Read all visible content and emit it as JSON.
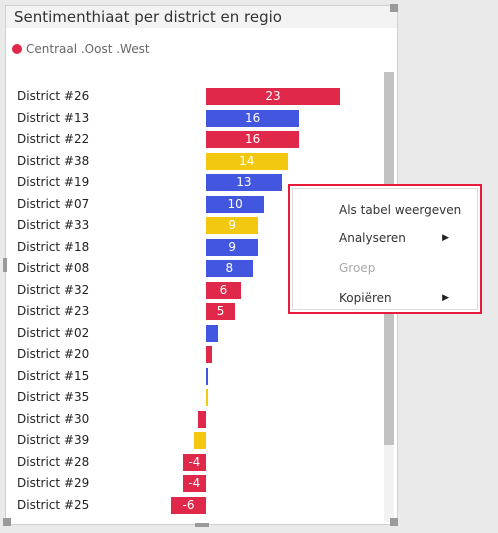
{
  "title": "Sentimenthiaat per district en regio",
  "legend": {
    "label": "Centraal .Oost .West",
    "color": "#e0294a"
  },
  "colors": {
    "Centraal": "#e0294a",
    "Oost": "#4356e0",
    "West": "#f2c811"
  },
  "chart_data": {
    "type": "bar",
    "orientation": "horizontal",
    "categories": [
      "District #26",
      "District #13",
      "District #22",
      "District #38",
      "District #19",
      "District #07",
      "District #33",
      "District #18",
      "District #08",
      "District #32",
      "District #23",
      "District #02",
      "District #20",
      "District #15",
      "District #35",
      "District #30",
      "District #39",
      "District #28",
      "District #29",
      "District #25"
    ],
    "values": [
      23,
      16,
      16,
      14,
      13,
      10,
      9,
      9,
      8,
      6,
      5,
      2,
      1,
      0.2,
      0.3,
      -1.3,
      -2,
      -4,
      -4,
      -6
    ],
    "labels": [
      "23",
      "16",
      "16",
      "14",
      "13",
      "10",
      "9",
      "9",
      "8",
      "6",
      "5",
      "",
      "",
      "",
      "",
      "",
      "",
      "-4",
      "-4",
      "-6"
    ],
    "regions": [
      "Centraal",
      "Oost",
      "Centraal",
      "West",
      "Oost",
      "Oost",
      "West",
      "Oost",
      "Oost",
      "Centraal",
      "Centraal",
      "Oost",
      "Centraal",
      "Oost",
      "West",
      "Centraal",
      "West",
      "Centraal",
      "Centraal",
      "Centraal"
    ]
  },
  "context_menu": {
    "items": [
      {
        "label": "Als tabel weergeven",
        "disabled": false,
        "submenu": false
      },
      {
        "label": "Analyseren",
        "disabled": false,
        "submenu": true
      },
      {
        "label": "Groep",
        "disabled": true,
        "submenu": false
      },
      {
        "label": "Kopiëren",
        "disabled": false,
        "submenu": true
      }
    ],
    "arrow": "▶"
  }
}
